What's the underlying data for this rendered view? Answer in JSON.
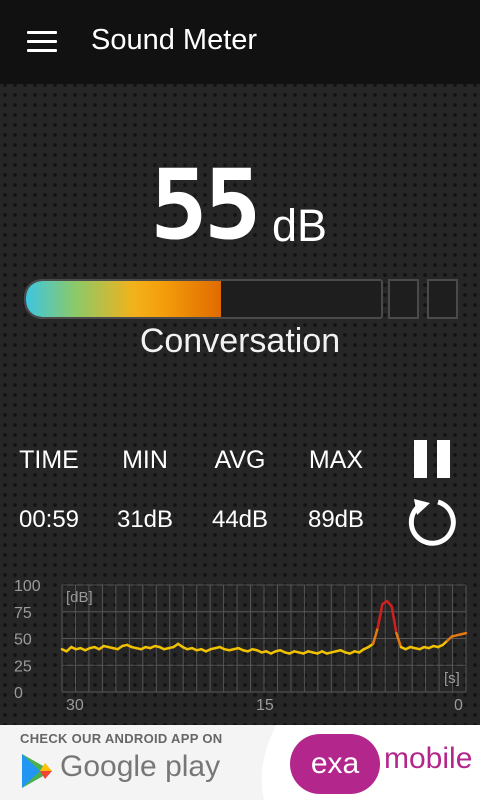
{
  "app": {
    "title": "Sound Meter"
  },
  "meter": {
    "value": "55",
    "unit": "dB",
    "level_fraction": 0.55,
    "label": "Conversation"
  },
  "stats": {
    "time": {
      "label": "TIME",
      "value": "00:59"
    },
    "min": {
      "label": "MIN",
      "value": "31dB"
    },
    "avg": {
      "label": "AVG",
      "value": "44dB"
    },
    "max": {
      "label": "MAX",
      "value": "89dB"
    }
  },
  "controls": {
    "pause_icon": "pause-icon",
    "reset_icon": "reset-icon"
  },
  "graph": {
    "y_ticks": [
      "100",
      "75",
      "50",
      "25",
      "0"
    ],
    "x_ticks": [
      "30",
      "15",
      "0"
    ],
    "y_unit": "[dB]",
    "x_unit": "[s]",
    "y_range": [
      0,
      100
    ],
    "x_range": [
      30,
      0
    ],
    "series": [
      40,
      38,
      42,
      40,
      41,
      39,
      41,
      42,
      40,
      43,
      42,
      41,
      40,
      43,
      44,
      42,
      41,
      40,
      42,
      41,
      43,
      42,
      40,
      41,
      42,
      45,
      42,
      40,
      41,
      39,
      40,
      38,
      40,
      41,
      42,
      40,
      39,
      40,
      41,
      39,
      38,
      40,
      39,
      37,
      38,
      36,
      38,
      39,
      37,
      36,
      38,
      37,
      36,
      38,
      37,
      36,
      38,
      36,
      37,
      38,
      39,
      37,
      36,
      38,
      37,
      40,
      42,
      45,
      60,
      82,
      85,
      80,
      55,
      42,
      40,
      42,
      41,
      40,
      42,
      41,
      43,
      42,
      44,
      48,
      52,
      53,
      54,
      55
    ],
    "colors": {
      "low": "#f2c200",
      "high": "#d02020"
    }
  },
  "ad": {
    "caption": "CHECK OUR ANDROID APP ON",
    "store": "Google play",
    "brand_left": "exa",
    "brand_right": "mobile"
  }
}
